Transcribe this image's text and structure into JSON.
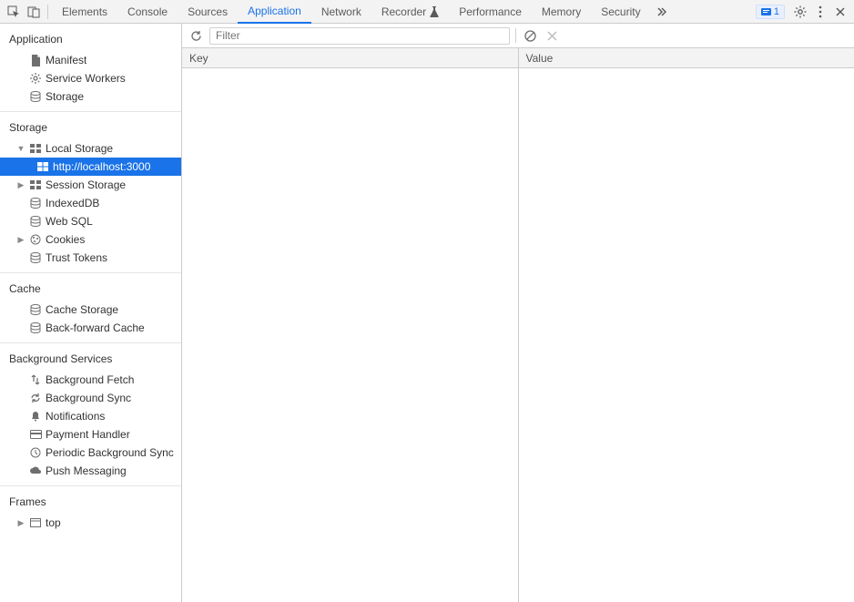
{
  "tabs": {
    "elements": "Elements",
    "console": "Console",
    "sources": "Sources",
    "application": "Application",
    "network": "Network",
    "recorder": "Recorder",
    "performance": "Performance",
    "memory": "Memory",
    "security": "Security"
  },
  "issues_count": "1",
  "sidebar": {
    "application": {
      "title": "Application",
      "manifest": "Manifest",
      "service_workers": "Service Workers",
      "storage": "Storage"
    },
    "storage": {
      "title": "Storage",
      "local_storage": "Local Storage",
      "local_storage_origin": "http://localhost:3000",
      "session_storage": "Session Storage",
      "indexeddb": "IndexedDB",
      "websql": "Web SQL",
      "cookies": "Cookies",
      "trust_tokens": "Trust Tokens"
    },
    "cache": {
      "title": "Cache",
      "cache_storage": "Cache Storage",
      "back_forward": "Back-forward Cache"
    },
    "background": {
      "title": "Background Services",
      "fetch": "Background Fetch",
      "sync": "Background Sync",
      "notifications": "Notifications",
      "payment": "Payment Handler",
      "periodic": "Periodic Background Sync",
      "push": "Push Messaging"
    },
    "frames": {
      "title": "Frames",
      "top": "top"
    }
  },
  "toolbar": {
    "filter_placeholder": "Filter"
  },
  "table": {
    "key": "Key",
    "value": "Value"
  }
}
